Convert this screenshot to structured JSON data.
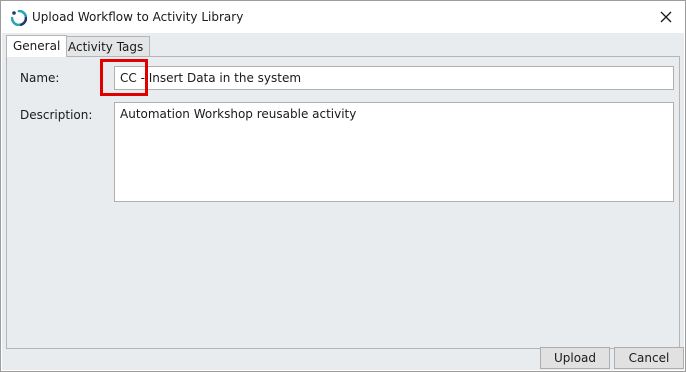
{
  "window": {
    "title": "Upload Workflow to Activity Library",
    "app_icon": "workflow-icon",
    "close_icon": "close-icon"
  },
  "tabs": [
    {
      "label": "General",
      "selected": true
    },
    {
      "label": "Activity Tags",
      "selected": false
    }
  ],
  "form": {
    "name_label": "Name:",
    "name_value": "CC - Insert Data in the system",
    "description_label": "Description:",
    "description_value": "Automation Workshop reusable activity"
  },
  "buttons": {
    "upload_label": "Upload",
    "cancel_label": "Cancel"
  },
  "colors": {
    "highlight": "#e00000",
    "panel_background": "#e9ecee",
    "icon_teal": "#2aa5b8",
    "icon_navy": "#1f3a66"
  }
}
